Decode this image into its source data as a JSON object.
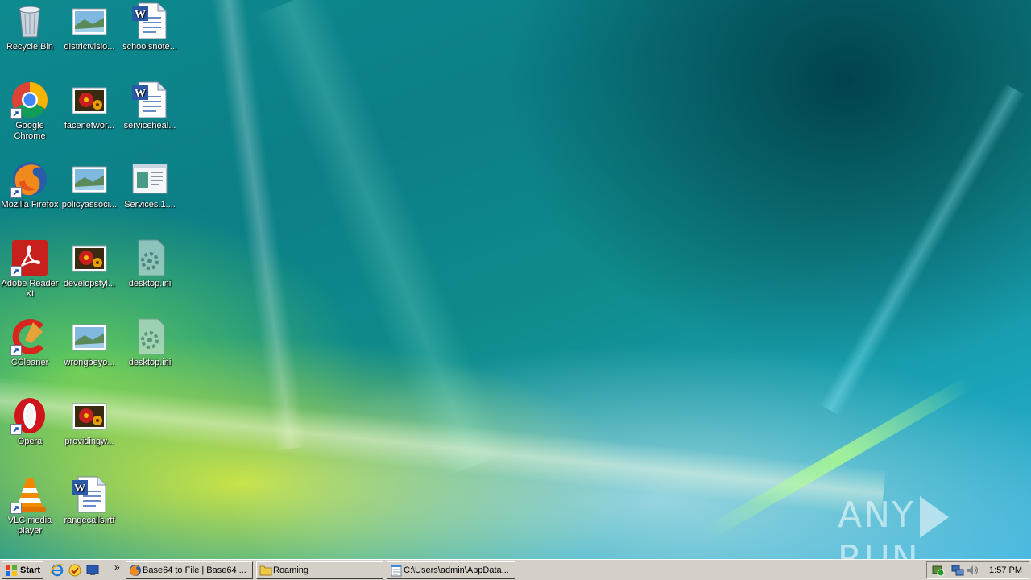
{
  "desktop": {
    "icons": [
      {
        "label": "Recycle Bin"
      },
      {
        "label": "districtvisio..."
      },
      {
        "label": "schoolsnote..."
      },
      {
        "label": "Google Chrome"
      },
      {
        "label": "facenetwor..."
      },
      {
        "label": "serviceheal..."
      },
      {
        "label": "Mozilla Firefox"
      },
      {
        "label": "policyassoci..."
      },
      {
        "label": "Services.1...."
      },
      {
        "label": "Adobe Reader XI"
      },
      {
        "label": "developstyl..."
      },
      {
        "label": "desktop.ini"
      },
      {
        "label": "CCleaner"
      },
      {
        "label": "wrongbeyo..."
      },
      {
        "label": "desktop.ini"
      },
      {
        "label": "Opera"
      },
      {
        "label": "providingw..."
      },
      {
        "label": "VLC media player"
      },
      {
        "label": "rangecalls.rtf"
      }
    ],
    "watermark": {
      "left": "ANY",
      "right": "RUN"
    }
  },
  "taskbar": {
    "start_label": "Start",
    "quick_launch_overflow": "»",
    "buttons": [
      {
        "label": "Base64 to File | Base64 ..."
      },
      {
        "label": "Roaming"
      },
      {
        "label": "C:\\Users\\admin\\AppData..."
      }
    ],
    "clock": "1:57 PM"
  }
}
